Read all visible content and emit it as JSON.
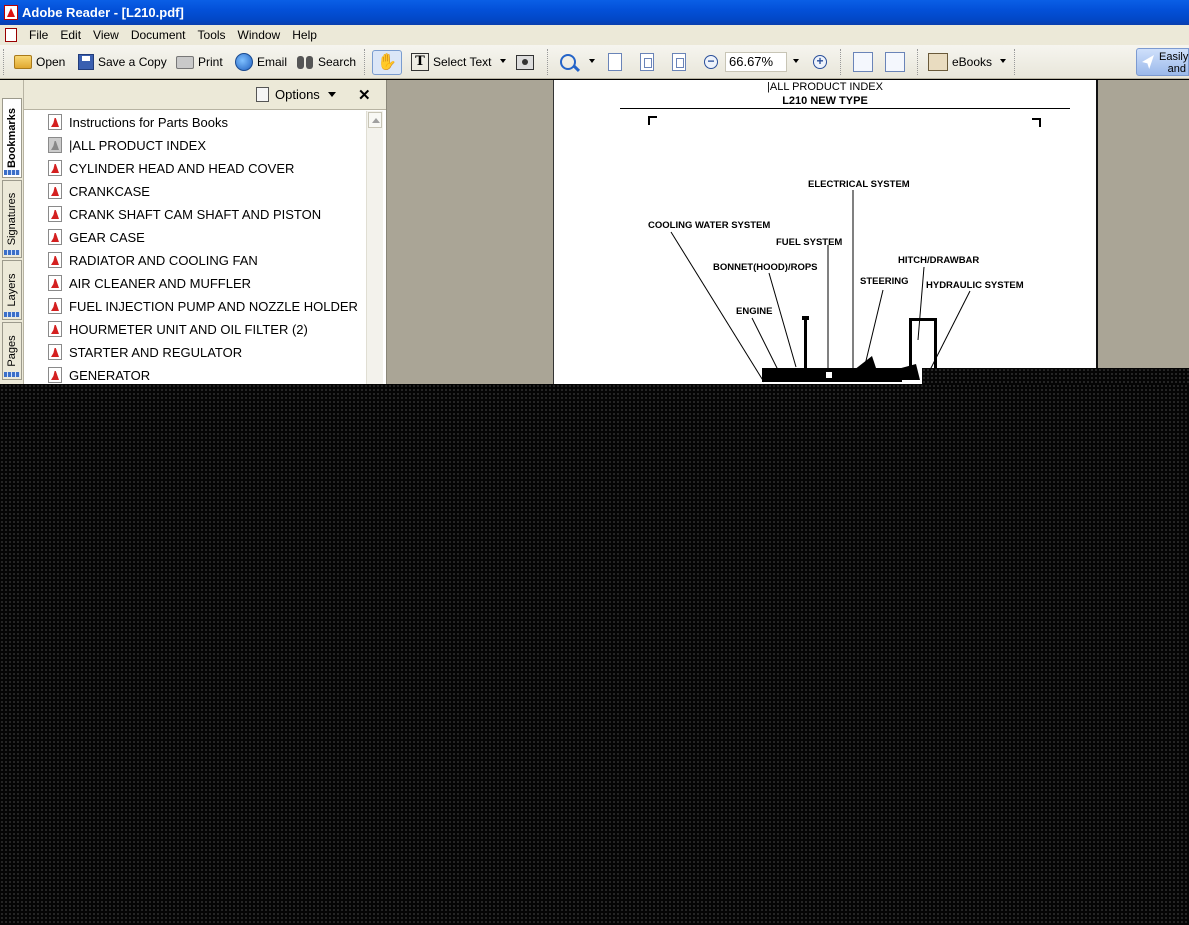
{
  "window": {
    "title": "Adobe Reader - [L210.pdf]"
  },
  "menu": [
    "File",
    "Edit",
    "View",
    "Document",
    "Tools",
    "Window",
    "Help"
  ],
  "toolbar": {
    "open": "Open",
    "save_copy": "Save a Copy",
    "print": "Print",
    "email": "Email",
    "search": "Search",
    "select_text": "Select Text",
    "zoom": "66.67%",
    "ebooks": "eBooks",
    "easily_line1": "Easily",
    "easily_line2": "and"
  },
  "nav_tabs": [
    "Bookmarks",
    "Signatures",
    "Layers",
    "Pages"
  ],
  "bookmarks_panel": {
    "options": "Options",
    "close": "✕",
    "items": [
      "Instructions for Parts Books",
      "|ALL PRODUCT INDEX",
      "CYLINDER HEAD AND HEAD COVER",
      "CRANKCASE",
      "CRANK SHAFT CAM SHAFT AND PISTON",
      "GEAR CASE",
      "RADIATOR AND COOLING FAN",
      "AIR CLEANER AND MUFFLER",
      "FUEL INJECTION PUMP AND NOZZLE HOLDER",
      "HOURMETER UNIT AND OIL FILTER (2)",
      "STARTER AND REGULATOR",
      "GENERATOR"
    ]
  },
  "document": {
    "header1": "|ALL PRODUCT INDEX",
    "header2": "L210 NEW TYPE",
    "labels": {
      "electrical": "ELECTRICAL SYSTEM",
      "cooling": "COOLING WATER SYSTEM",
      "fuel": "FUEL SYSTEM",
      "bonnet": "BONNET(HOOD)/ROPS",
      "hitch": "HITCH/DRAWBAR",
      "steering": "STEERING",
      "hydraulic": "HYDRAULIC SYSTEM",
      "engine": "ENGINE"
    }
  },
  "colors": {
    "titlebar": "#0350d8",
    "chrome": "#ece9d8",
    "doc_bg": "#aaa596"
  },
  "icons": [
    "open-folder-icon",
    "save-disk-icon",
    "printer-icon",
    "email-icon",
    "binoculars-icon",
    "hand-tool-icon",
    "select-text-icon",
    "snapshot-camera-icon",
    "zoom-in-icon",
    "actual-size-icon",
    "fit-page-icon",
    "fit-width-icon",
    "zoom-out-icon",
    "zoom-plus-icon",
    "rotate-icon",
    "ebook-icon",
    "pdf-bookmark-icon"
  ]
}
